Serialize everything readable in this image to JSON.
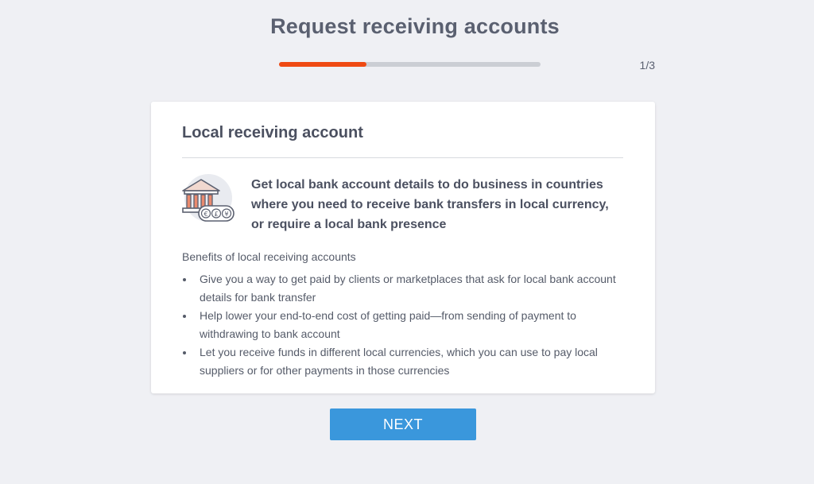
{
  "header": {
    "title": "Request receiving accounts",
    "progress": {
      "current_step": 1,
      "total_steps": 3,
      "fraction": 0.333,
      "label": "1/3"
    },
    "progress_color": "#ef4a13"
  },
  "card": {
    "title": "Local receiving account",
    "icon": "bank-currency-icon",
    "headline": "Get local bank account details to do business in countries where you need to receive bank transfers in local currency, or require a local bank presence",
    "benefits_title": "Benefits of local receiving accounts",
    "benefits": [
      "Give you a way to get paid by clients or marketplaces that ask for local bank account details for bank transfer",
      "Help lower your end-to-end cost of getting paid—from sending of payment to withdrawing to bank account",
      "Let you receive funds in different local currencies, which you can use to pay local suppliers or for other payments in those currencies"
    ],
    "currency_symbols": [
      "€",
      "£",
      "¥"
    ]
  },
  "footer": {
    "next_label": "NEXT",
    "next_color": "#3a97dc"
  }
}
